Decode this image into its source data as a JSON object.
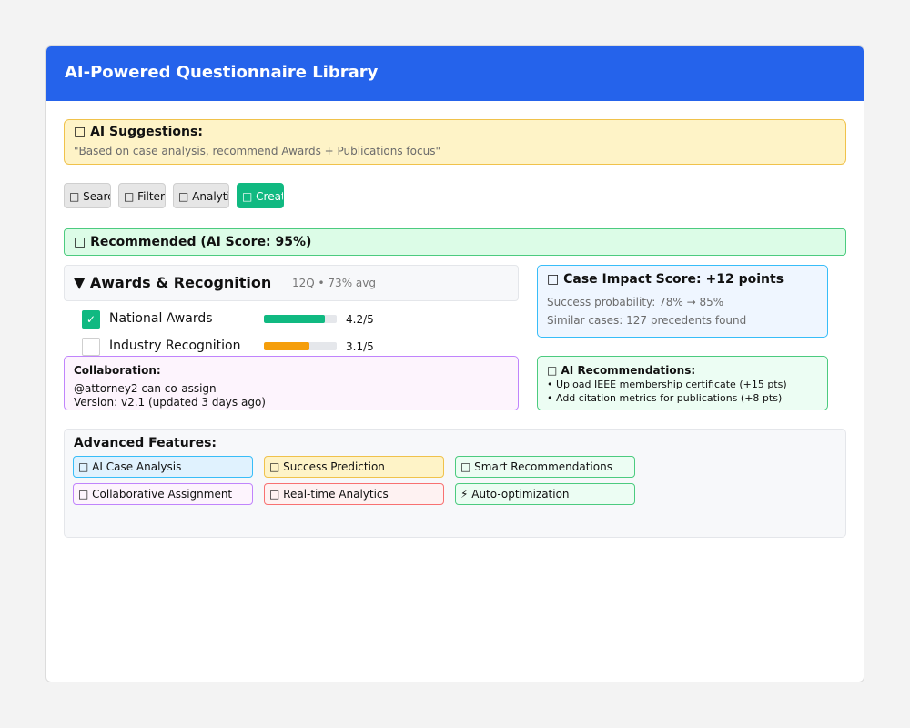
{
  "header": {
    "title": "AI-Powered Questionnaire Library"
  },
  "suggestion": {
    "icon": "bulb-icon",
    "title": "□ AI Suggestions:",
    "text": "\"Based on case analysis, recommend Awards + Publications focus\""
  },
  "toolbar": {
    "search_label": "□ Search",
    "filter_label": "□ Filter",
    "analytics_label": "□ Analytics",
    "create_label": "□ Create"
  },
  "recommended": {
    "label": "□ Recommended (AI Score: 95%)"
  },
  "category": {
    "title": "▼ Awards & Recognition",
    "meta": "12Q • 73% avg",
    "items": [
      {
        "label": "National Awards",
        "checked": true,
        "check_mark": "✓",
        "rating": "4.2/5",
        "score_fraction": 0.84,
        "bar_color": "#10b981"
      },
      {
        "label": "Industry Recognition",
        "checked": false,
        "check_mark": "",
        "rating": "3.1/5",
        "score_fraction": 0.62,
        "bar_color": "#f59e0b"
      }
    ]
  },
  "impact": {
    "title": "□ Case Impact Score: +12 points",
    "success": "Success probability: 78% → 85%",
    "similar": "Similar cases: 127 precedents found"
  },
  "collaboration": {
    "title": "Collaboration:",
    "assign": "@attorney2 can co-assign",
    "version": "Version: v2.1 (updated 3 days ago)"
  },
  "ai_recommendations": {
    "title": "□ AI Recommendations:",
    "items": [
      "• Upload IEEE membership certificate (+15 pts)",
      "• Add citation metrics for publications (+8 pts)"
    ]
  },
  "advanced": {
    "title": "Advanced Features:",
    "features": [
      {
        "label": "□ AI Case Analysis",
        "bg": "#e0f2fe",
        "border": "#38bdf8"
      },
      {
        "label": "□ Success Prediction",
        "bg": "#fef3c7",
        "border": "#f0c24b"
      },
      {
        "label": "□ Smart Recommendations",
        "bg": "#ecfdf3",
        "border": "#4ccb7f"
      },
      {
        "label": "□ Collaborative Assignment",
        "bg": "#fdf4fd",
        "border": "#c084fc"
      },
      {
        "label": "□ Real-time Analytics",
        "bg": "#fef2f2",
        "border": "#f87171"
      },
      {
        "label": "⚡ Auto-optimization",
        "bg": "#ecfdf3",
        "border": "#4ccb7f"
      }
    ]
  },
  "colors": {
    "header": "#2563eb",
    "accent": "#10b981",
    "warning": "#f59e0b"
  }
}
